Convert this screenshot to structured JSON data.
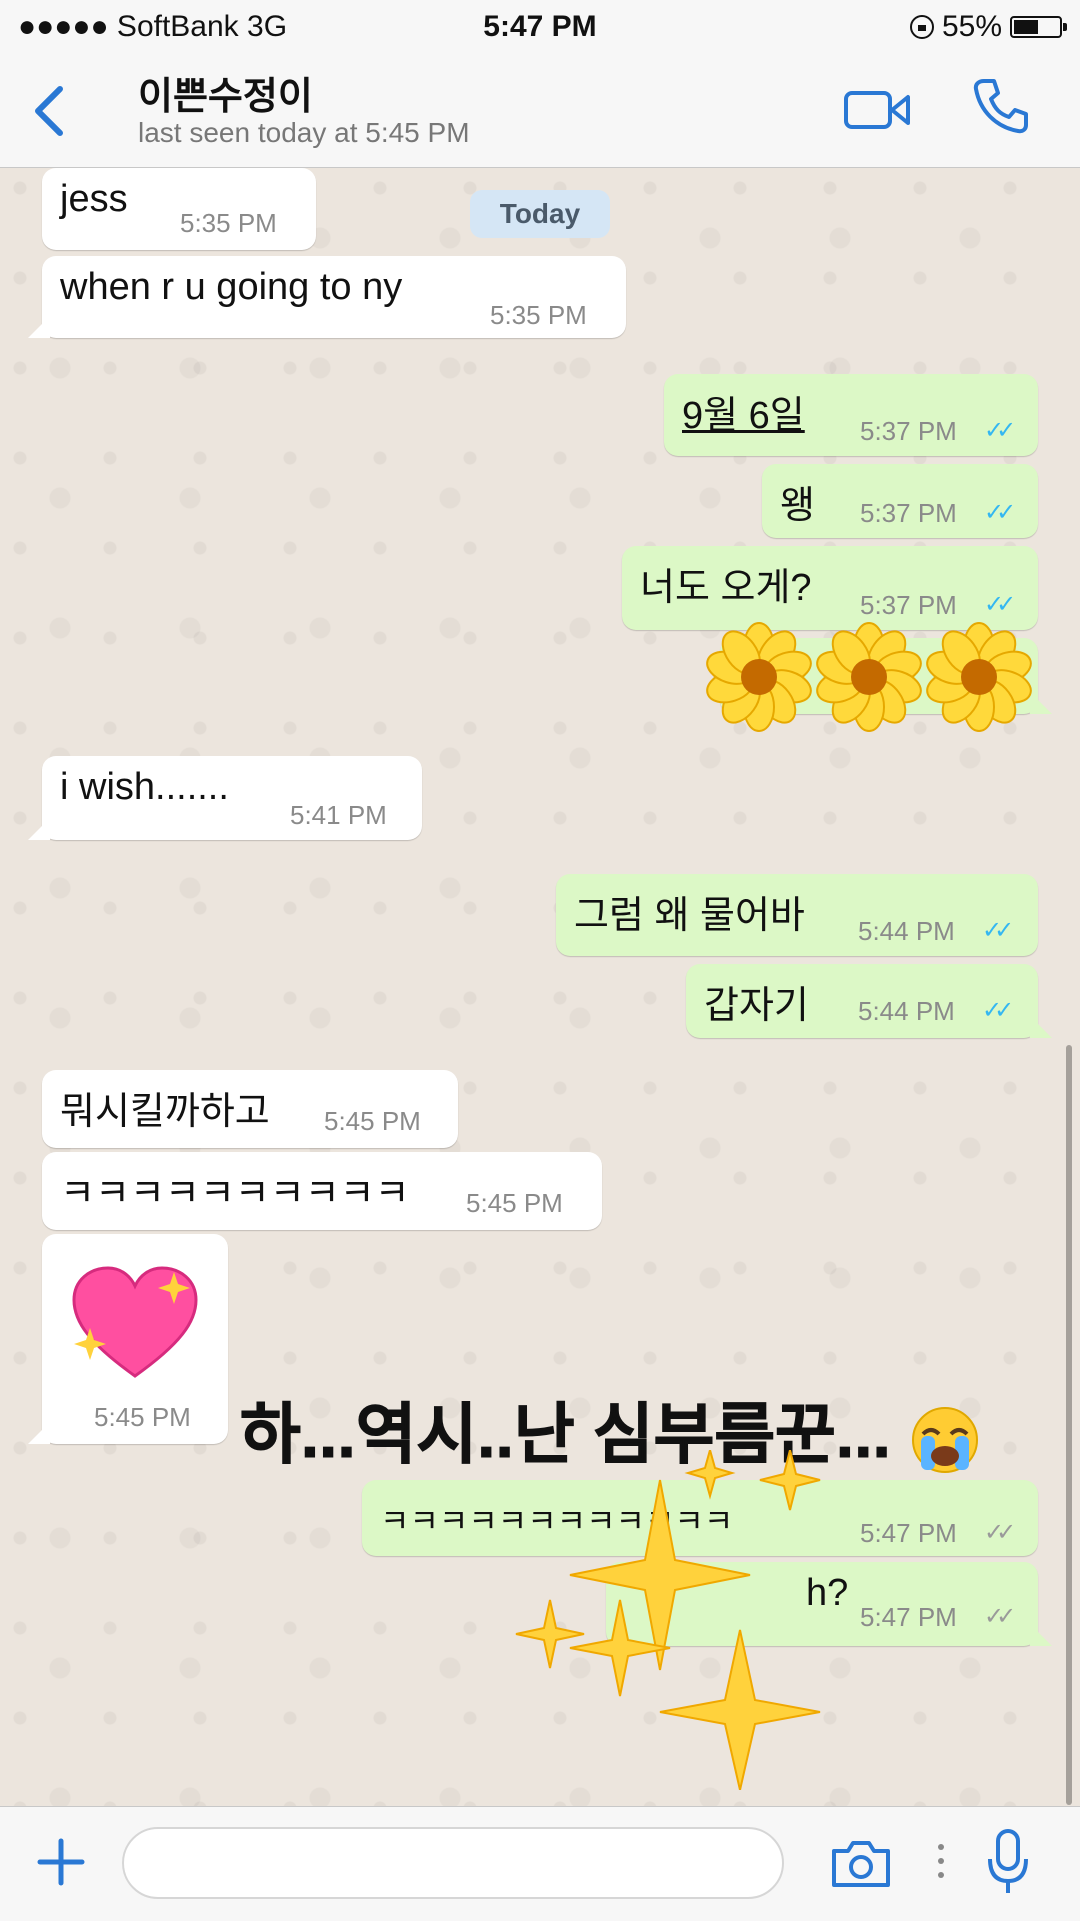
{
  "status_bar": {
    "carrier": "●●●●● SoftBank  3G",
    "time": "5:47 PM",
    "battery": "55%",
    "battery_level": 0.55
  },
  "header": {
    "contact_name": "이쁜수정이",
    "last_seen": "last seen today at 5:45 PM"
  },
  "date_separator": "Today",
  "messages": [
    {
      "text": "jess",
      "time": "5:35 PM"
    },
    {
      "text": "when r u going to ny",
      "time": "5:35 PM"
    },
    {
      "text": "9월 6일",
      "time": "5:37 PM"
    },
    {
      "text": "왱",
      "time": "5:37 PM"
    },
    {
      "text": "너도 오게?",
      "time": "5:37 PM"
    },
    {
      "text": "i wish.......",
      "time": "5:41 PM"
    },
    {
      "text": "그럼 왜 물어바",
      "time": "5:44 PM"
    },
    {
      "text": "갑자기",
      "time": "5:44 PM"
    },
    {
      "text": "뭐시킬까하고",
      "time": "5:45 PM"
    },
    {
      "text": "ㅋㅋㅋㅋㅋㅋㅋㅋㅋㅋ",
      "time": "5:45 PM"
    },
    {
      "text": "",
      "time": "5:45 PM"
    },
    {
      "text": "ㅋㅋㅋㅋㅋㅋㅋㅋㅋㅋㅋㅋ",
      "time": "5:47 PM"
    },
    {
      "text": "h?",
      "time": "5:47 PM"
    }
  ],
  "overlay_caption": "하...역시..난 심부름꾼...",
  "icons": {
    "back": "chevron-left-icon",
    "video": "video-camera-icon",
    "call": "phone-icon",
    "plus": "plus-icon",
    "camera": "camera-icon",
    "mic": "microphone-icon"
  },
  "colors": {
    "accent": "#2a78d4",
    "outgoing_bubble": "#dcf8c6",
    "incoming_bubble": "#ffffff",
    "read_tick": "#34b7f1"
  }
}
